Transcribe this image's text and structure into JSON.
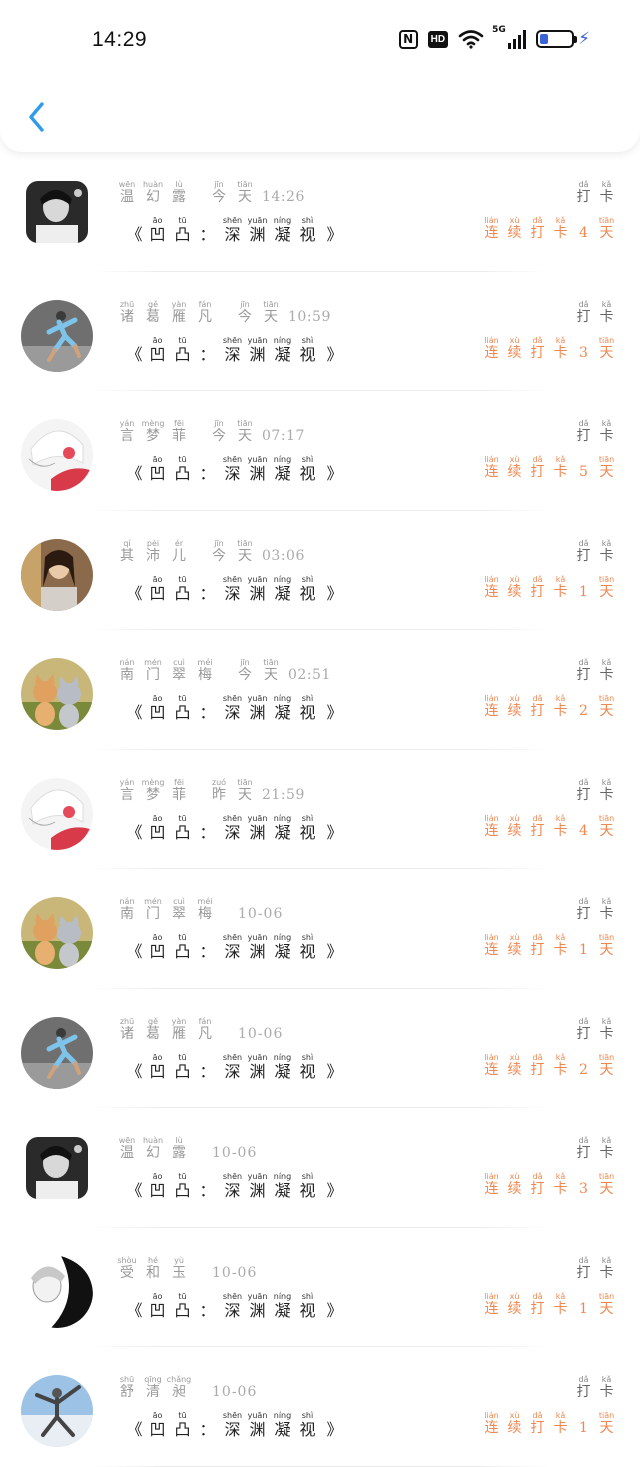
{
  "status_bar": {
    "time": "14:29",
    "icons": [
      "nfc-icon",
      "hd-icon",
      "wifi-icon",
      "5g-signal-icon",
      "battery-icon",
      "charging-icon"
    ],
    "hd_label": "HD",
    "network_label": "5G",
    "nfc_label": "N"
  },
  "nav": {
    "back_icon": "chevron-left-icon",
    "accent": "#2f9bea"
  },
  "colors": {
    "streak": "#f0874e",
    "meta": "#9a9a9a",
    "title": "#222222"
  },
  "common": {
    "title_open": "《",
    "title_close": "》",
    "title_chars": [
      {
        "py": "āo",
        "ch": "凹"
      },
      {
        "py": "tū",
        "ch": "凸"
      },
      {
        "py": "",
        "ch": "："
      },
      {
        "py": "shēn",
        "ch": "深"
      },
      {
        "py": "yuān",
        "ch": "渊"
      },
      {
        "py": "níng",
        "ch": "凝"
      },
      {
        "py": "shì",
        "ch": "视"
      }
    ],
    "punch_chars": [
      {
        "py": "dǎ",
        "ch": "打"
      },
      {
        "py": "kǎ",
        "ch": "卡"
      }
    ],
    "streak_pre": [
      {
        "py": "lián",
        "ch": "连"
      },
      {
        "py": "xù",
        "ch": "续"
      },
      {
        "py": "dǎ",
        "ch": "打"
      },
      {
        "py": "kǎ",
        "ch": "卡"
      }
    ],
    "streak_post": {
      "py": "tiān",
      "ch": "天"
    }
  },
  "entries": [
    {
      "avatar": "avatar-portrait-smoking",
      "name": [
        {
          "py": "wēn",
          "ch": "温"
        },
        {
          "py": "huàn",
          "ch": "幻"
        },
        {
          "py": "lù",
          "ch": "露"
        }
      ],
      "day": [
        {
          "py": "jīn",
          "ch": "今"
        },
        {
          "py": "tiān",
          "ch": "天"
        }
      ],
      "clock": "14:26",
      "streak": "4"
    },
    {
      "avatar": "avatar-runner",
      "name": [
        {
          "py": "zhū",
          "ch": "诸"
        },
        {
          "py": "gě",
          "ch": "葛"
        },
        {
          "py": "yàn",
          "ch": "雁"
        },
        {
          "py": "fán",
          "ch": "凡"
        }
      ],
      "day": [
        {
          "py": "jīn",
          "ch": "今"
        },
        {
          "py": "tiān",
          "ch": "天"
        }
      ],
      "clock": "10:59",
      "streak": "3"
    },
    {
      "avatar": "avatar-anime-red",
      "name": [
        {
          "py": "yán",
          "ch": "言"
        },
        {
          "py": "mèng",
          "ch": "梦"
        },
        {
          "py": "fēi",
          "ch": "菲"
        }
      ],
      "day": [
        {
          "py": "jīn",
          "ch": "今"
        },
        {
          "py": "tiān",
          "ch": "天"
        }
      ],
      "clock": "07:17",
      "streak": "5"
    },
    {
      "avatar": "avatar-girl-photo",
      "name": [
        {
          "py": "qí",
          "ch": "其"
        },
        {
          "py": "pèi",
          "ch": "沛"
        },
        {
          "py": "ér",
          "ch": "儿"
        }
      ],
      "day": [
        {
          "py": "jīn",
          "ch": "今"
        },
        {
          "py": "tiān",
          "ch": "天"
        }
      ],
      "clock": "03:06",
      "streak": "1"
    },
    {
      "avatar": "avatar-cats",
      "name": [
        {
          "py": "nán",
          "ch": "南"
        },
        {
          "py": "mén",
          "ch": "门"
        },
        {
          "py": "cuì",
          "ch": "翠"
        },
        {
          "py": "méi",
          "ch": "梅"
        }
      ],
      "day": [
        {
          "py": "jīn",
          "ch": "今"
        },
        {
          "py": "tiān",
          "ch": "天"
        }
      ],
      "clock": "02:51",
      "streak": "2"
    },
    {
      "avatar": "avatar-anime-red",
      "name": [
        {
          "py": "yán",
          "ch": "言"
        },
        {
          "py": "mèng",
          "ch": "梦"
        },
        {
          "py": "fēi",
          "ch": "菲"
        }
      ],
      "day": [
        {
          "py": "zuó",
          "ch": "昨"
        },
        {
          "py": "tiān",
          "ch": "天"
        }
      ],
      "clock": "21:59",
      "streak": "4"
    },
    {
      "avatar": "avatar-cats",
      "name": [
        {
          "py": "nán",
          "ch": "南"
        },
        {
          "py": "mén",
          "ch": "门"
        },
        {
          "py": "cuì",
          "ch": "翠"
        },
        {
          "py": "méi",
          "ch": "梅"
        }
      ],
      "day": [],
      "clock": "10-06",
      "streak": "1"
    },
    {
      "avatar": "avatar-runner",
      "name": [
        {
          "py": "zhū",
          "ch": "诸"
        },
        {
          "py": "gě",
          "ch": "葛"
        },
        {
          "py": "yàn",
          "ch": "雁"
        },
        {
          "py": "fán",
          "ch": "凡"
        }
      ],
      "day": [],
      "clock": "10-06",
      "streak": "2"
    },
    {
      "avatar": "avatar-portrait-smoking",
      "name": [
        {
          "py": "wēn",
          "ch": "温"
        },
        {
          "py": "huàn",
          "ch": "幻"
        },
        {
          "py": "lù",
          "ch": "露"
        }
      ],
      "day": [],
      "clock": "10-06",
      "streak": "3"
    },
    {
      "avatar": "avatar-anime-bw",
      "name": [
        {
          "py": "shòu",
          "ch": "受"
        },
        {
          "py": "hé",
          "ch": "和"
        },
        {
          "py": "yù",
          "ch": "玉"
        }
      ],
      "day": [],
      "clock": "10-06",
      "streak": "1"
    },
    {
      "avatar": "avatar-dancer",
      "name": [
        {
          "py": "shū",
          "ch": "舒"
        },
        {
          "py": "qīng",
          "ch": "清"
        },
        {
          "py": "chǎng",
          "ch": "昶"
        }
      ],
      "day": [],
      "clock": "10-06",
      "streak": "1"
    }
  ]
}
